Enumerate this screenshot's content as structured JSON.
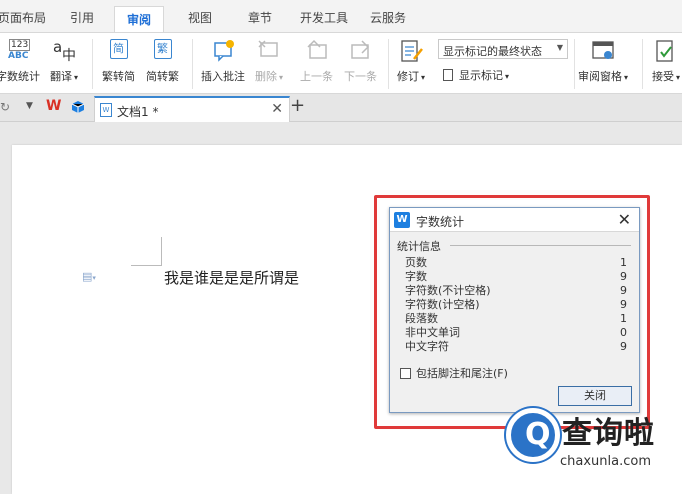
{
  "menu": {
    "tabs": [
      {
        "label": "页面布局"
      },
      {
        "label": "引用"
      },
      {
        "label": "审阅"
      },
      {
        "label": "视图"
      },
      {
        "label": "章节"
      },
      {
        "label": "开发工具"
      },
      {
        "label": "云服务"
      }
    ],
    "active_tab": "审阅"
  },
  "ribbon": {
    "word_count": "字数统计",
    "translate": "翻译",
    "trad_to_simp": "繁转简",
    "simp_to_trad": "简转繁",
    "insert_comment": "插入批注",
    "delete": "删除",
    "previous": "上一条",
    "next": "下一条",
    "revise": "修订",
    "show_markup_state": "显示标记的最终状态",
    "show_markup": "显示标记",
    "review_pane": "审阅窗格",
    "accept": "接受",
    "icon_123": "123",
    "icon_abc": "ABC",
    "icon_jian": "简",
    "icon_fan": "繁",
    "icon_a": "a",
    "icon_zhong": "中"
  },
  "doc_tab": {
    "name": "文档1 *"
  },
  "document": {
    "text": "我是谁是是是所谓是"
  },
  "dialog": {
    "title": "字数统计",
    "section": "统计信息",
    "stats": [
      {
        "label": "页数",
        "value": "1"
      },
      {
        "label": "字数",
        "value": "9"
      },
      {
        "label": "字符数(不计空格)",
        "value": "9"
      },
      {
        "label": "字符数(计空格)",
        "value": "9"
      },
      {
        "label": "段落数",
        "value": "1"
      },
      {
        "label": "非中文单词",
        "value": "0"
      },
      {
        "label": "中文字符",
        "value": "9"
      }
    ],
    "checkbox_label": "包括脚注和尾注(F)",
    "close_label": "关闭"
  },
  "watermark": {
    "q": "Q",
    "name": "查询啦",
    "url": "chaxunla.com"
  },
  "colors": {
    "accent": "#1f6fd6",
    "highlight": "#e03a3a",
    "wps_red": "#d93025"
  }
}
